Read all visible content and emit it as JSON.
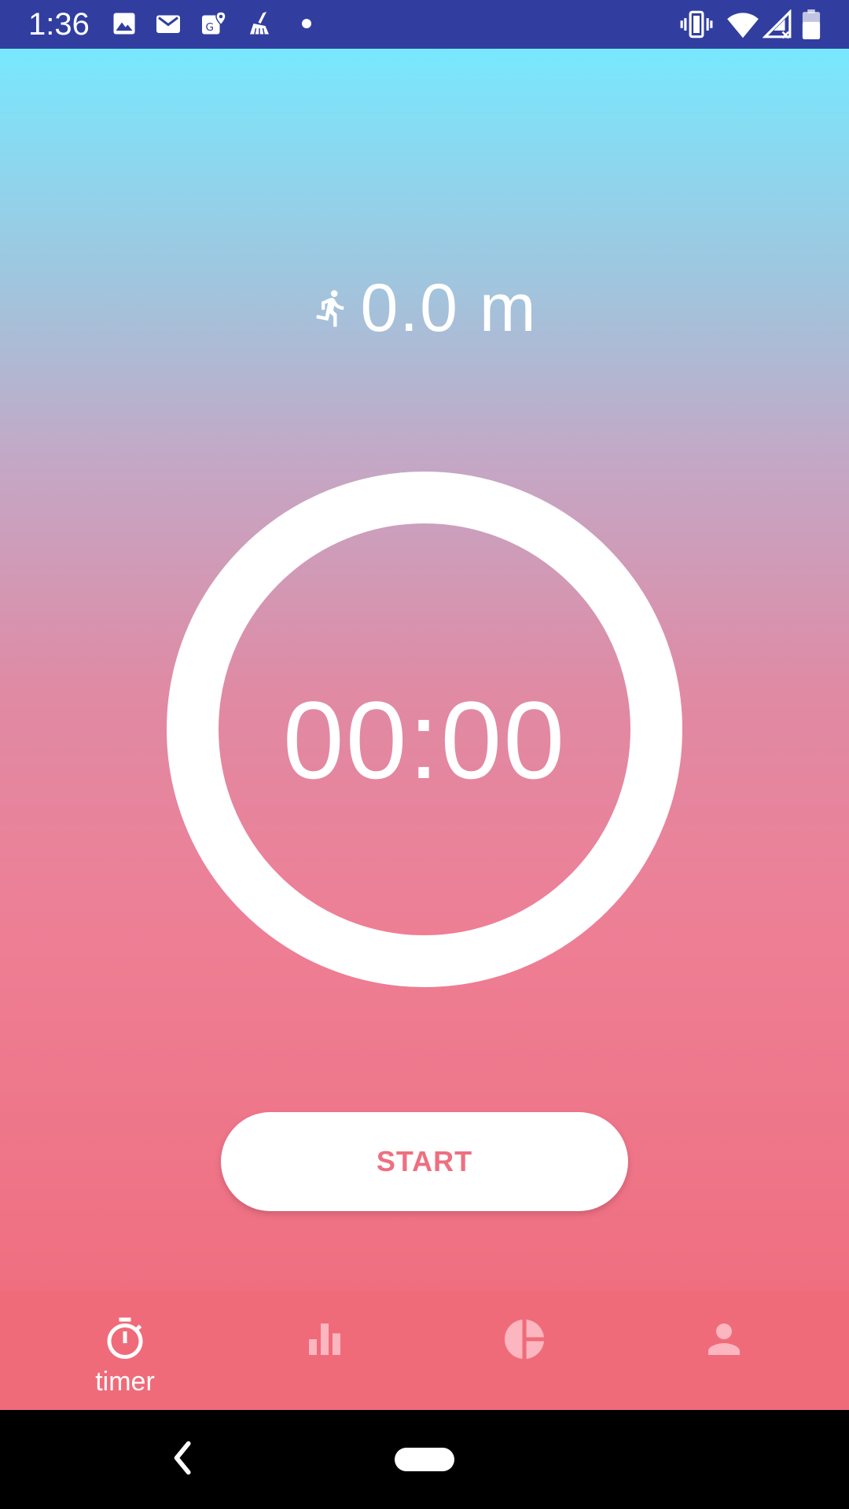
{
  "status_bar": {
    "time": "1:36",
    "left_icons": [
      "photos-icon",
      "gmail-icon",
      "maps-icon",
      "cleaner-icon",
      "dot-icon"
    ],
    "right_icons": [
      "vibrate-icon",
      "wifi-icon",
      "signal-icon",
      "battery-icon"
    ]
  },
  "distance": {
    "value": "0.0 m",
    "icon": "runner-icon"
  },
  "timer": {
    "display": "00:00"
  },
  "start_button": {
    "label": "START"
  },
  "bottom_nav": {
    "items": [
      {
        "id": "timer",
        "label": "timer",
        "icon": "stopwatch-icon",
        "active": true
      },
      {
        "id": "stats",
        "label": "",
        "icon": "bar-chart-icon",
        "active": false
      },
      {
        "id": "breakdown",
        "label": "",
        "icon": "pie-chart-icon",
        "active": false
      },
      {
        "id": "profile",
        "label": "",
        "icon": "person-icon",
        "active": false
      }
    ]
  },
  "colors": {
    "status_bar": "#313ea0",
    "accent": "#ee6f80",
    "nav_background": "#f06b79",
    "gradient_top": "#78e8fe",
    "gradient_bottom": "#ef6f80"
  }
}
